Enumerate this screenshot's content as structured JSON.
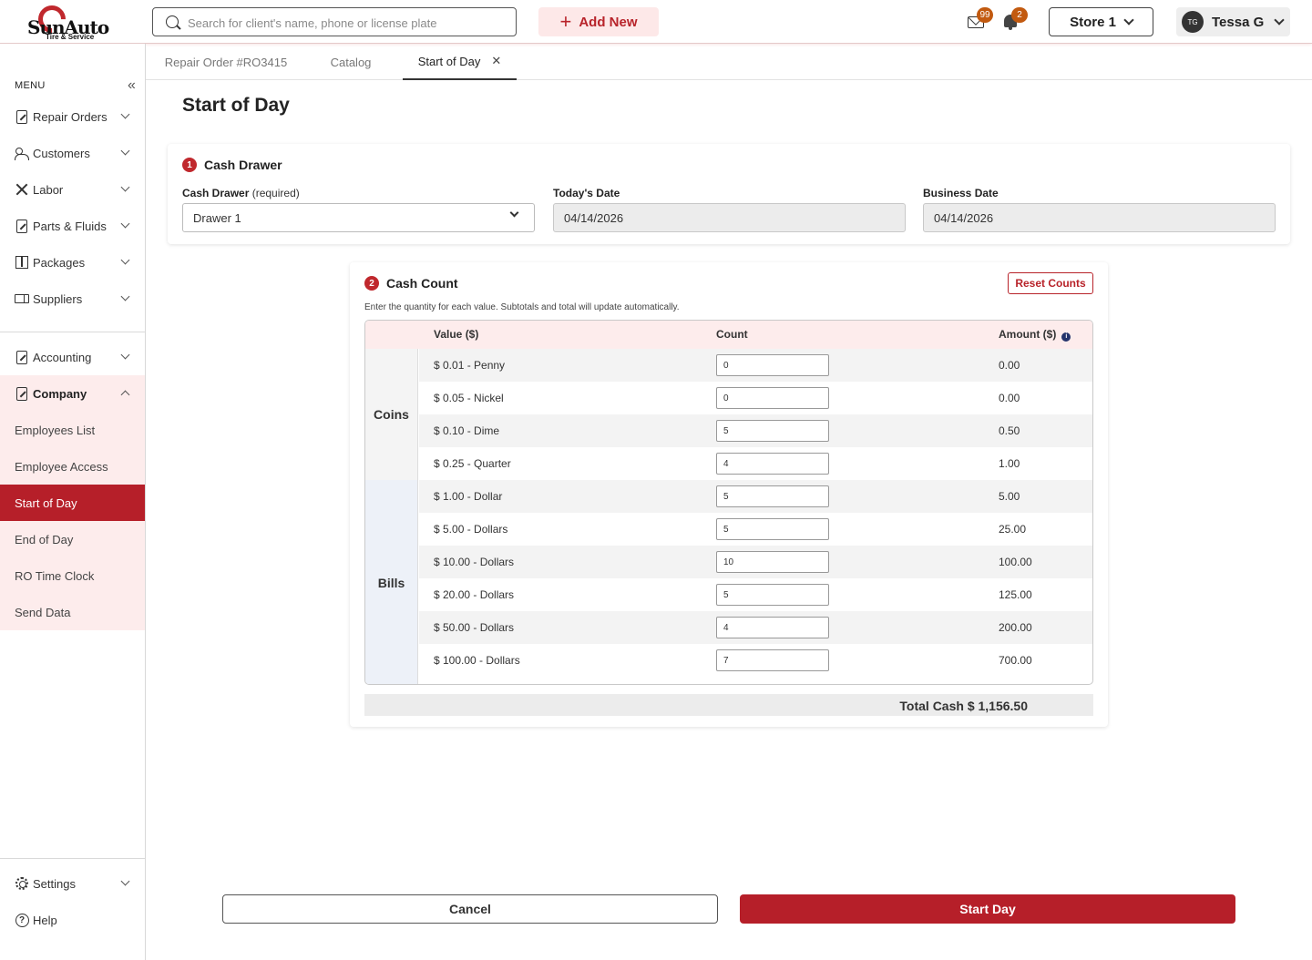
{
  "header": {
    "logo_text": "SunAuto",
    "logo_sub": "Tire & Service",
    "search_placeholder": "Search for client's name, phone or license plate",
    "add_new_label": "Add New",
    "mail_badge": "99",
    "bell_badge": "2",
    "store_label": "Store 1",
    "user_initials": "TG",
    "user_name": "Tessa G"
  },
  "sidebar": {
    "menu_label": "MENU",
    "items": [
      {
        "label": "Repair Orders",
        "icon": "repair-order-icon"
      },
      {
        "label": "Customers",
        "icon": "customers-icon"
      },
      {
        "label": "Labor",
        "icon": "tools-icon"
      },
      {
        "label": "Parts & Fluids",
        "icon": "parts-icon"
      },
      {
        "label": "Packages",
        "icon": "package-icon"
      },
      {
        "label": "Suppliers",
        "icon": "truck-icon"
      },
      {
        "label": "Accounting",
        "icon": "accounting-icon"
      },
      {
        "label": "Company",
        "icon": "company-icon"
      }
    ],
    "company_sub": [
      {
        "label": "Employees List"
      },
      {
        "label": "Employee Access"
      },
      {
        "label": "Start of Day"
      },
      {
        "label": "End of Day"
      },
      {
        "label": "RO Time Clock"
      },
      {
        "label": "Send Data"
      }
    ],
    "settings_label": "Settings",
    "help_label": "Help"
  },
  "tabs": [
    {
      "label": "Repair Order #RO3415"
    },
    {
      "label": "Catalog"
    },
    {
      "label": "Start of Day"
    }
  ],
  "page_title": "Start of Day",
  "cash_drawer": {
    "step": "1",
    "title": "Cash Drawer",
    "drawer_label": "Cash Drawer",
    "drawer_required": "(required)",
    "drawer_value": "Drawer 1",
    "today_label": "Today's Date",
    "today_value": "04/14/2026",
    "business_label": "Business Date",
    "business_value": "04/14/2026"
  },
  "cash_count": {
    "step": "2",
    "title": "Cash Count",
    "reset_label": "Reset Counts",
    "hint": "Enter the quantity for each value. Subtotals and total will update automatically.",
    "col_value": "Value ($)",
    "col_count": "Count",
    "col_amount": "Amount ($)",
    "group_coins": "Coins",
    "group_bills": "Bills",
    "rows": [
      {
        "value": "$ 0.01 - Penny",
        "count": "0",
        "amount": "0.00"
      },
      {
        "value": "$ 0.05 - Nickel",
        "count": "0",
        "amount": "0.00"
      },
      {
        "value": "$ 0.10 - Dime",
        "count": "5",
        "amount": "0.50"
      },
      {
        "value": "$ 0.25 - Quarter",
        "count": "4",
        "amount": "1.00"
      },
      {
        "value": "$ 1.00 - Dollar",
        "count": "5",
        "amount": "5.00"
      },
      {
        "value": "$ 5.00 - Dollars",
        "count": "5",
        "amount": "25.00"
      },
      {
        "value": "$ 10.00 - Dollars",
        "count": "10",
        "amount": "100.00"
      },
      {
        "value": "$ 20.00 - Dollars",
        "count": "5",
        "amount": "125.00"
      },
      {
        "value": "$ 50.00 - Dollars",
        "count": "4",
        "amount": "200.00"
      },
      {
        "value": "$ 100.00 - Dollars",
        "count": "7",
        "amount": "700.00"
      }
    ],
    "total_label": "Total Cash $ 1,156.50"
  },
  "footer": {
    "cancel_label": "Cancel",
    "start_label": "Start Day"
  },
  "colors": {
    "brand": "#b61f29",
    "accent_light": "#fdecec"
  }
}
